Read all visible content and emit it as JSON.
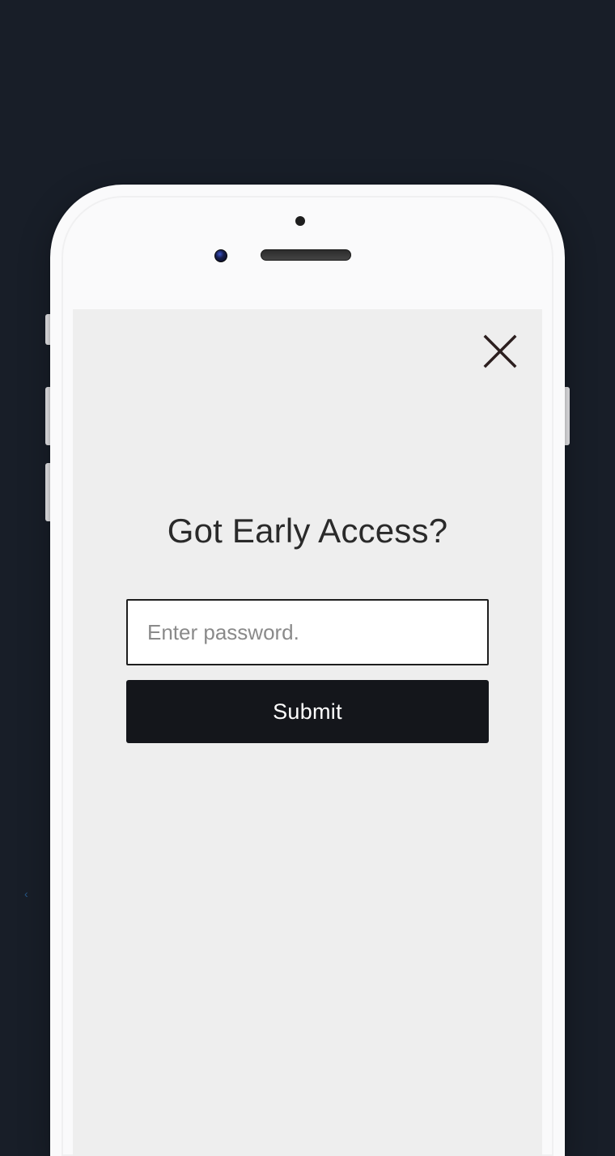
{
  "modal": {
    "heading": "Got Early Access?",
    "password_placeholder": "Enter password.",
    "submit_label": "Submit"
  }
}
